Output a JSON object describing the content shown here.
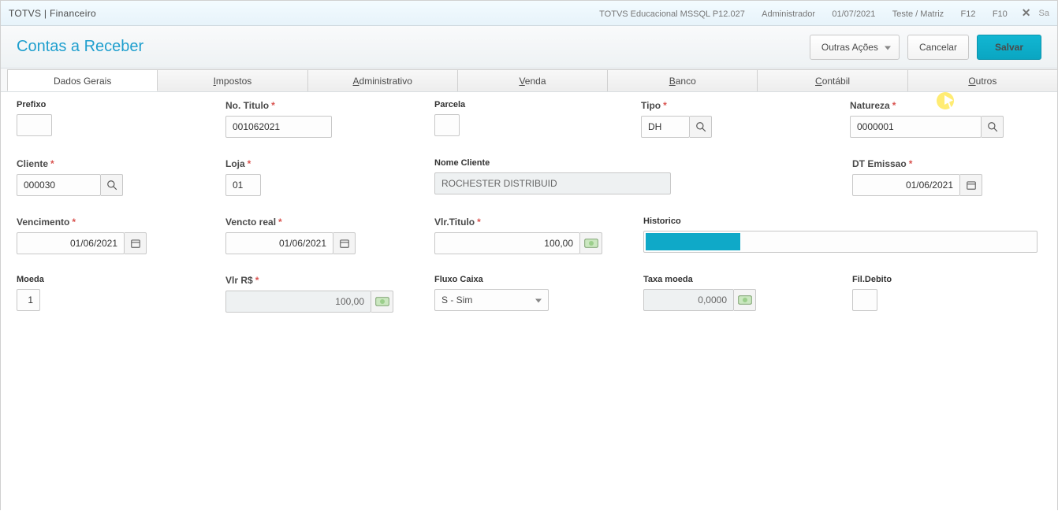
{
  "titlebar": {
    "app_brand": "TOTVS",
    "app_divider": " | ",
    "app_module": "Financeiro",
    "environment": "TOTVS Educacional MSSQL P12.027",
    "user": "Administrador",
    "date": "01/07/2021",
    "company": "Teste / Matriz",
    "fkey1": "F12",
    "fkey2": "F10",
    "exit_text": "Sa"
  },
  "subheader": {
    "page_title": "Contas a Receber",
    "other_actions_label": "Outras Ações",
    "cancel_label": "Cancelar",
    "save_label": "Salvar"
  },
  "tabs": {
    "t0": {
      "label": "Dados Gerais"
    },
    "t1": {
      "prefix": "I",
      "suffix": "mpostos"
    },
    "t2": {
      "prefix": "A",
      "suffix": "dministrativo"
    },
    "t3": {
      "prefix": "V",
      "suffix": "enda"
    },
    "t4": {
      "prefix": "B",
      "suffix": "anco"
    },
    "t5": {
      "prefix": "C",
      "suffix": "ontábil"
    },
    "t6": {
      "prefix": "O",
      "suffix": "utros"
    }
  },
  "form": {
    "prefixo": {
      "label": "Prefixo",
      "value": ""
    },
    "no_titulo": {
      "label": "No. Titulo",
      "value": "001062021"
    },
    "parcela": {
      "label": "Parcela",
      "value": ""
    },
    "tipo": {
      "label": "Tipo",
      "value": "DH"
    },
    "natureza": {
      "label": "Natureza",
      "value": "0000001"
    },
    "cliente": {
      "label": "Cliente",
      "value": "000030"
    },
    "loja": {
      "label": "Loja",
      "value": "01"
    },
    "nome_cliente": {
      "label": "Nome Cliente",
      "value": "ROCHESTER DISTRIBUID"
    },
    "dt_emissao": {
      "label": "DT Emissao",
      "value": "01/06/2021"
    },
    "vencimento": {
      "label": "Vencimento",
      "value": "01/06/2021"
    },
    "vencto_real": {
      "label": "Vencto real",
      "value": "01/06/2021"
    },
    "vlr_titulo": {
      "label": "Vlr.Titulo",
      "value": "100,00"
    },
    "historico": {
      "label": "Historico",
      "value": ""
    },
    "moeda": {
      "label": "Moeda",
      "value": "1"
    },
    "vlr_rs": {
      "label": "Vlr R$",
      "value": "100,00"
    },
    "fluxo_caixa": {
      "label": "Fluxo Caixa",
      "value": "S - Sim"
    },
    "taxa_moeda": {
      "label": "Taxa moeda",
      "value": "0,0000"
    },
    "fil_debito": {
      "label": "Fil.Debito",
      "value": ""
    },
    "req_mark": "*"
  }
}
